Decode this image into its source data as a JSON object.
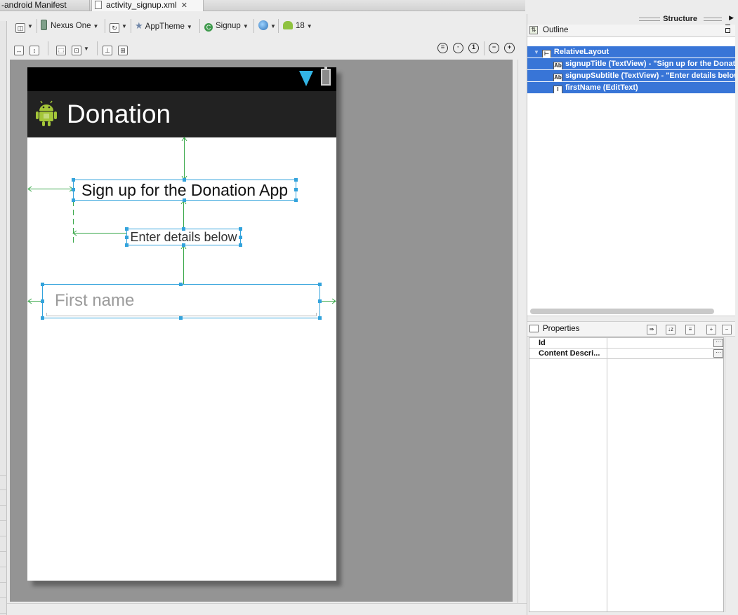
{
  "editor": {
    "tabs": [
      {
        "label": "-android Manifest"
      },
      {
        "label": "activity_signup.xml",
        "close_icon": "close-icon"
      }
    ]
  },
  "toolbar": {
    "device": "Nexus One",
    "theme": "AppTheme",
    "activity": "Signup",
    "api_level": "18"
  },
  "device": {
    "app_title": "Donation",
    "signup_title": "Sign up for the Donation App",
    "signup_subtitle": "Enter details below",
    "first_name_hint": "First name"
  },
  "structure": {
    "title": "Structure",
    "outline_title": "Outline",
    "tree": [
      {
        "label": "RelativeLayout",
        "icon": "relative-layout-icon"
      },
      {
        "label": "signupTitle (TextView) - \"Sign up for the Donation App\"",
        "icon": "textview-icon"
      },
      {
        "label": "signupSubtitle (TextView) - \"Enter details below\"",
        "icon": "textview-icon"
      },
      {
        "label": "firstName (EditText)",
        "icon": "edittext-icon"
      }
    ]
  },
  "properties": {
    "title": "Properties",
    "rows": [
      {
        "key": "Id"
      },
      {
        "key": "Content Descri..."
      }
    ]
  },
  "colors": {
    "selection": "#3875d7",
    "canvas": "#949494",
    "action_bar": "#222222",
    "guide_blue": "#33a3dc",
    "guide_green": "#3aa84a"
  }
}
